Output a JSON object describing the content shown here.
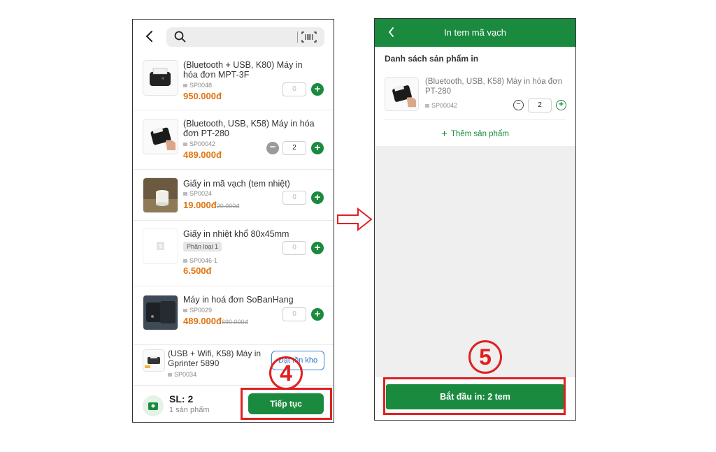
{
  "left": {
    "search": {
      "placeholder": ""
    },
    "products": [
      {
        "name": "(Bluetooth + USB, K80) Máy in hóa đơn MPT-3F",
        "sku": "SP0048",
        "price": "950.000đ",
        "old_price": "",
        "qty": "0"
      },
      {
        "name": "(Bluetooth, USB, K58) Máy in hóa đơn PT-280",
        "sku": "SP00042",
        "price": "489.000đ",
        "old_price": "",
        "qty": "2"
      },
      {
        "name": "Giấy in mã vạch (tem nhiệt)",
        "sku": "SP0024",
        "price": "19.000đ",
        "old_price": "20.000đ",
        "qty": "0"
      },
      {
        "name": "Giấy in nhiệt khổ 80x45mm",
        "variant": "Phân loại 1",
        "sku": "SP0046-1",
        "price": "6.500đ",
        "old_price": "",
        "qty": "0"
      },
      {
        "name": "Máy in hoá đơn SoBanHang",
        "sku": "SP0029",
        "price": "489.000đ",
        "old_price": "690.000đ",
        "qty": "0"
      },
      {
        "name": "(USB + Wifi, K58) Máy in Gprinter 5890",
        "sku": "SP0034",
        "stock_button": "Đặt tồn kho"
      }
    ],
    "footer": {
      "sl_label": "SL: 2",
      "sl_sub": "1 sản phẩm",
      "continue_label": "Tiếp tục"
    }
  },
  "right": {
    "header_title": "In tem mã vạch",
    "section_title": "Danh sách sản phẩm in",
    "item": {
      "name": "(Bluetooth, USB, K58) Máy in hóa đơn PT-280",
      "sku": "SP00042",
      "qty": "2"
    },
    "add_label": "Thêm sản phẩm",
    "start_label": "Bắt đầu in: 2 tem"
  },
  "annotations": {
    "step4": "4",
    "step5": "5"
  },
  "colors": {
    "primary_green": "#1a8a3f",
    "price_orange": "#e07410",
    "annotation_red": "#e02020"
  },
  "icons": [
    "back-icon",
    "search-icon",
    "barcode-scan-icon",
    "plus-icon",
    "minus-icon",
    "cart-icon",
    "arrow-right-icon"
  ]
}
